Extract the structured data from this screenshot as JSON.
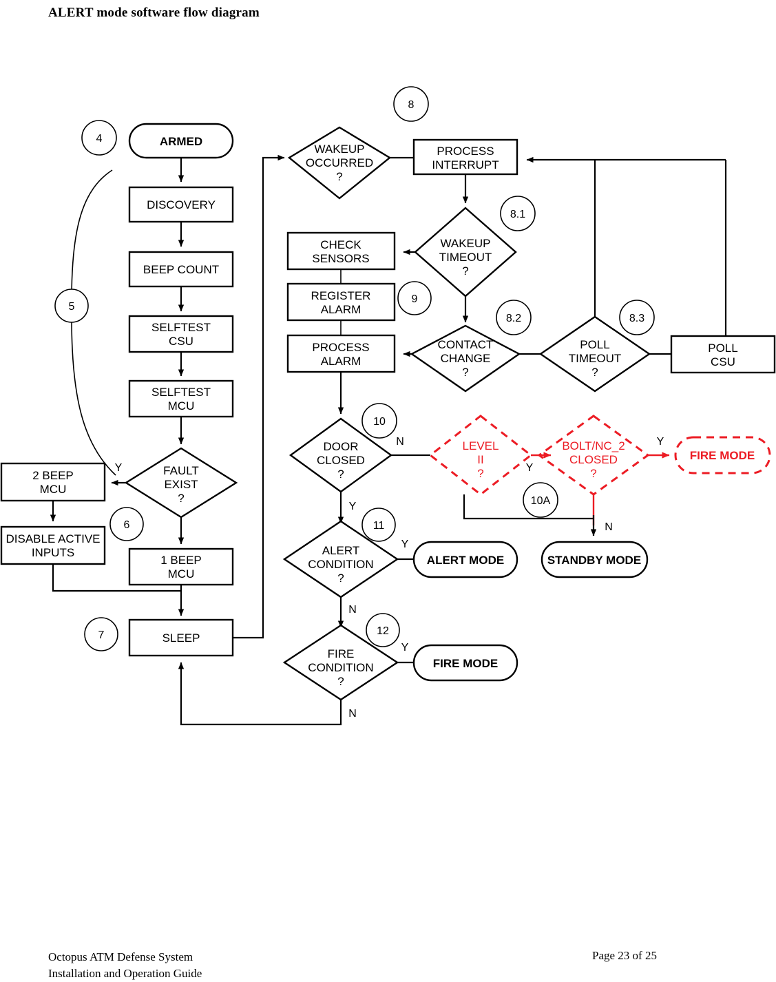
{
  "page": {
    "title": "ALERT mode software flow diagram",
    "footer_line1": "Octopus ATM Defense System",
    "footer_line2": "Installation and Operation Guide",
    "footer_page": "Page 23 of 25"
  },
  "colors": {
    "black": "#000000",
    "red": "#ec1c24",
    "white": "#ffffff"
  },
  "nodes": {
    "armed": "ARMED",
    "discovery": "DISCOVERY",
    "beep_count": "BEEP COUNT",
    "selftest_csu_1": "SELFTEST",
    "selftest_csu_2": "CSU",
    "selftest_mcu_1": "SELFTEST",
    "selftest_mcu_2": "MCU",
    "fault_exist_1": "FAULT",
    "fault_exist_2": "EXIST",
    "fault_exist_3": "?",
    "two_beep_1": "2 BEEP",
    "two_beep_2": "MCU",
    "disable_inputs_1": "DISABLE ACTIVE",
    "disable_inputs_2": "INPUTS",
    "one_beep_1": "1 BEEP",
    "one_beep_2": "MCU",
    "sleep": "SLEEP",
    "wakeup_occurred_1": "WAKEUP",
    "wakeup_occurred_2": "OCCURRED",
    "wakeup_occurred_3": "?",
    "process_interrupt_1": "PROCESS",
    "process_interrupt_2": "INTERRUPT",
    "wakeup_timeout_1": "WAKEUP",
    "wakeup_timeout_2": "TIMEOUT",
    "wakeup_timeout_3": "?",
    "check_sensors_1": "CHECK",
    "check_sensors_2": "SENSORS",
    "register_alarm_1": "REGISTER",
    "register_alarm_2": "ALARM",
    "process_alarm_1": "PROCESS",
    "process_alarm_2": "ALARM",
    "contact_change_1": "CONTACT",
    "contact_change_2": "CHANGE",
    "contact_change_3": "?",
    "poll_timeout_1": "POLL",
    "poll_timeout_2": "TIMEOUT",
    "poll_timeout_3": "?",
    "poll_csu_1": "POLL",
    "poll_csu_2": "CSU",
    "door_closed_1": "DOOR",
    "door_closed_2": "CLOSED",
    "door_closed_3": "?",
    "alert_condition_1": "ALERT",
    "alert_condition_2": "CONDITION",
    "alert_condition_3": "?",
    "fire_condition_1": "FIRE",
    "fire_condition_2": "CONDITION",
    "fire_condition_3": "?",
    "alert_mode": "ALERT MODE",
    "fire_mode_12": "FIRE MODE",
    "standby_mode": "STANDBY MODE",
    "level_ii_1": "LEVEL",
    "level_ii_2": "II",
    "level_ii_3": "?",
    "bolt_closed_1": "BOLT/NC_2",
    "bolt_closed_2": "CLOSED",
    "bolt_closed_3": "?",
    "fire_mode_red": "FIRE MODE"
  },
  "refs": {
    "r4": "4",
    "r5": "5",
    "r6": "6",
    "r7": "7",
    "r8": "8",
    "r81": "8.1",
    "r82": "8.2",
    "r83": "8.3",
    "r9": "9",
    "r10": "10",
    "r10a": "10A",
    "r11": "11",
    "r12": "12"
  },
  "branch_labels": {
    "fault_y": "Y",
    "door_n": "N",
    "door_y": "Y",
    "alert_y": "Y",
    "alert_n": "N",
    "fire_y": "Y",
    "fire_n": "N",
    "level_y": "Y",
    "bolt_y": "Y",
    "bolt_n": "N"
  }
}
